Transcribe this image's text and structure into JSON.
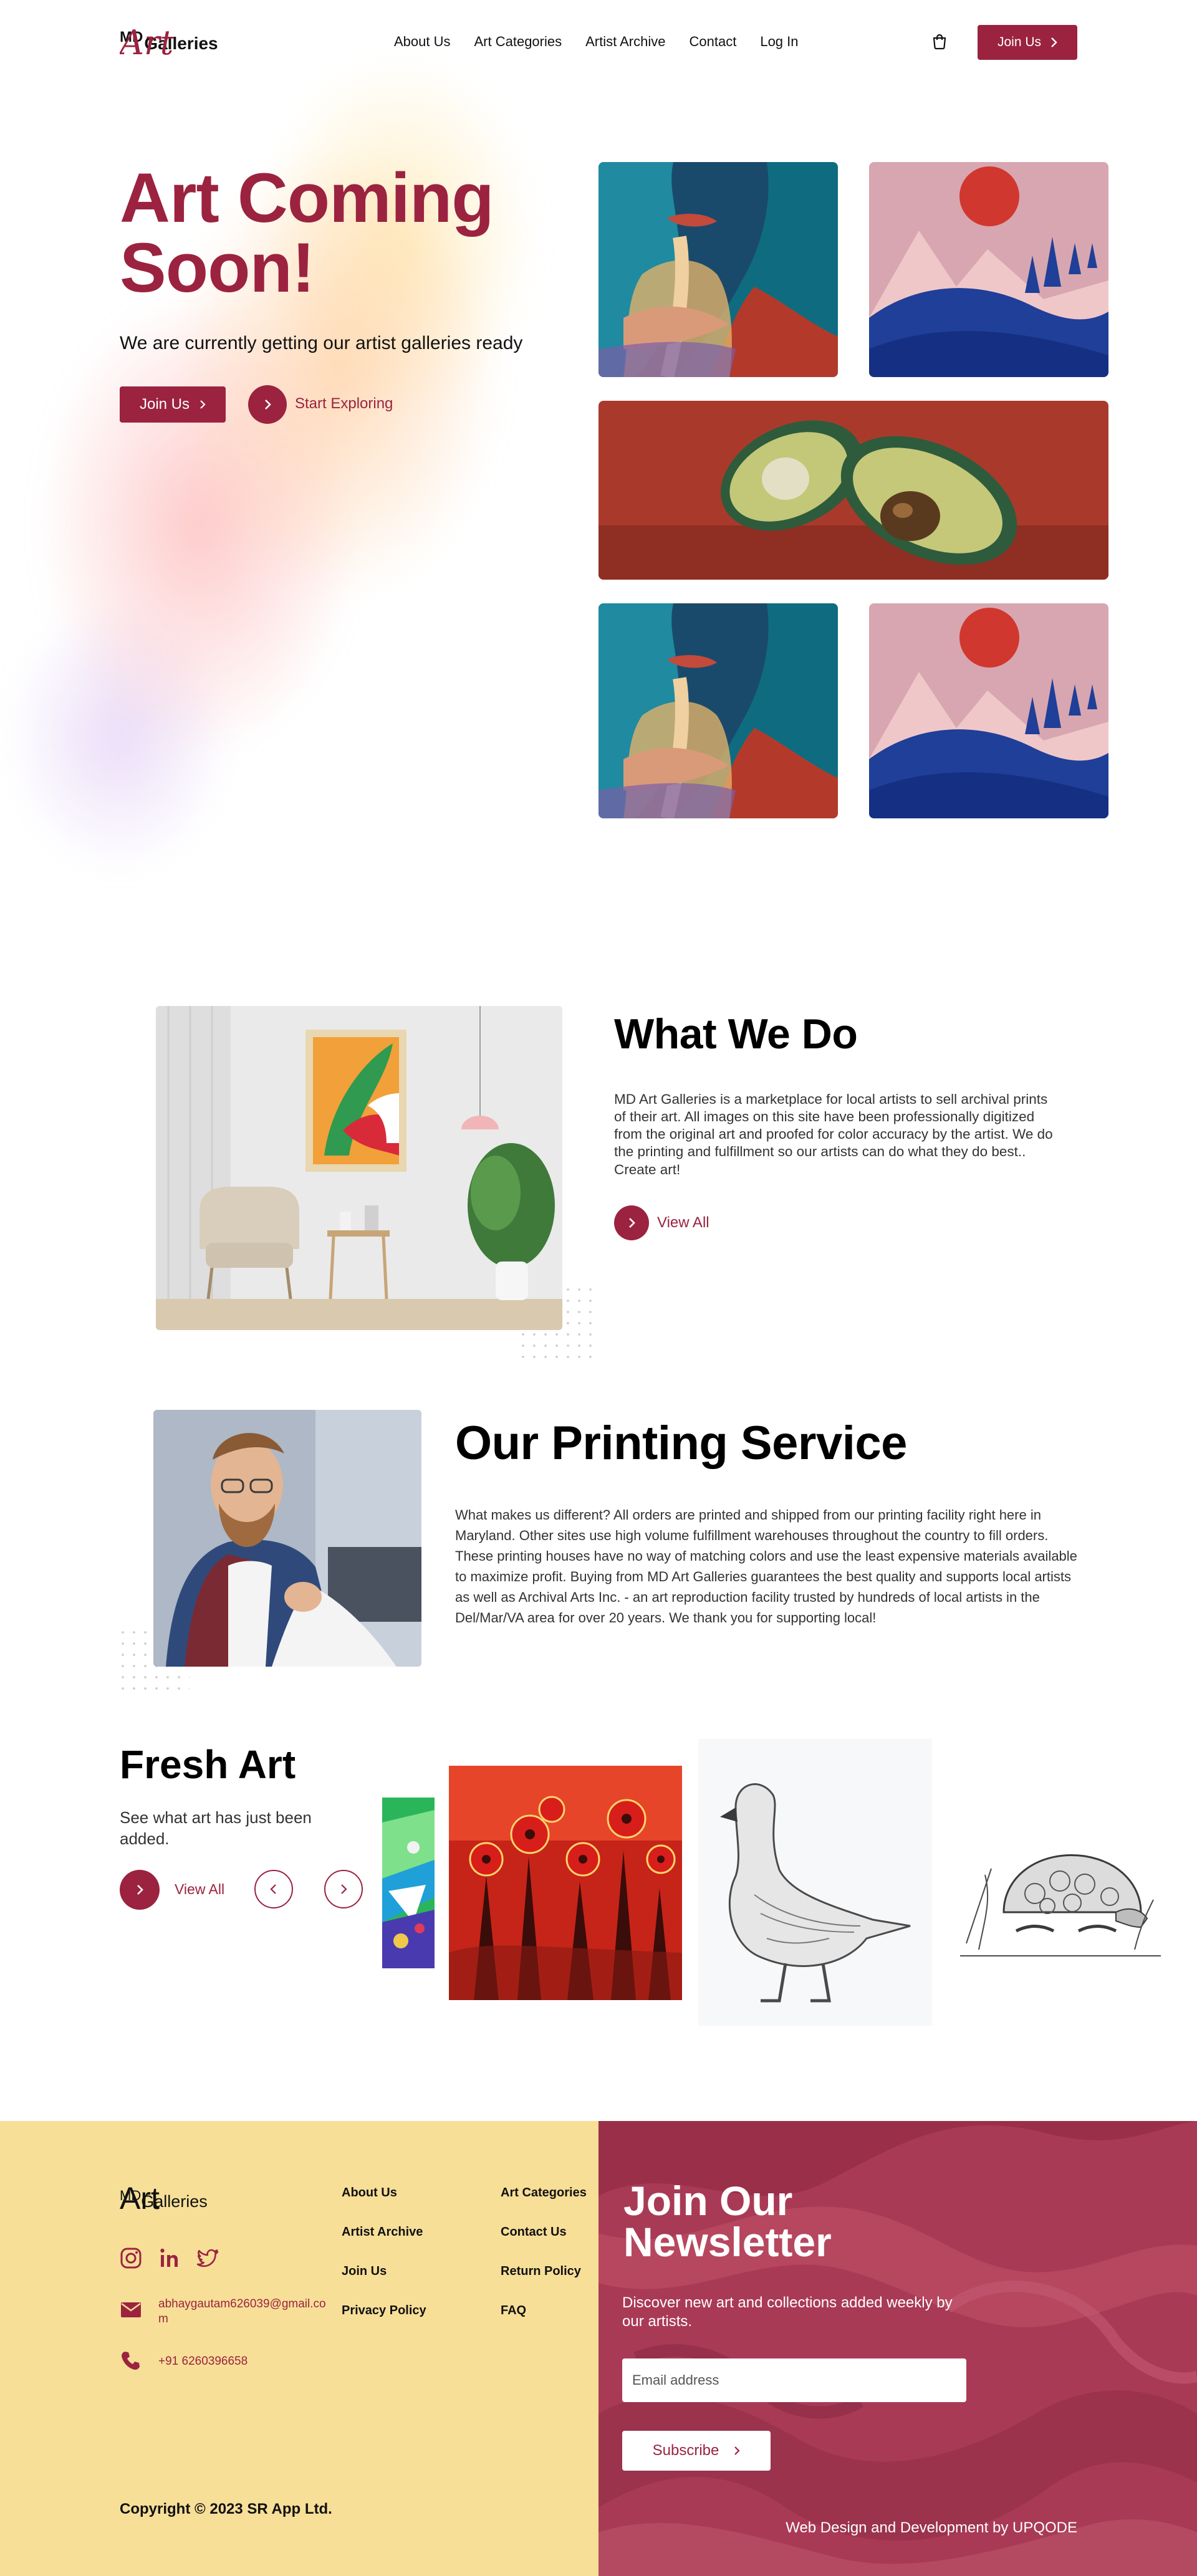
{
  "header": {
    "logo": {
      "md": "MD",
      "art": "Art",
      "galleries": "Galleries"
    },
    "nav": [
      "About Us",
      "Art Categories",
      "Artist Archive",
      "Contact",
      "Log In"
    ],
    "join_label": "Join Us"
  },
  "hero": {
    "title": "Art Coming Soon!",
    "subtitle": "We are currently getting our artist galleries ready",
    "join_label": "Join Us",
    "explore_label": "Start Exploring"
  },
  "what_we_do": {
    "title": "What We Do",
    "text": "MD Art Galleries is a marketplace for local artists to sell archival prints of their art. All images on this site have been professionally digitized from the original art and proofed for color accuracy by the artist. We do the printing and fulfillment so our artists can do what they do best.. Create art!",
    "view_label": "View All"
  },
  "printing": {
    "title": "Our Printing Service",
    "text": "What makes us different? All orders are printed and shipped from our printing facility right here in Maryland. Other sites use high volume fulfillment warehouses throughout the country to fill orders. These printing houses have no way of matching colors and use the least expensive materials available to maximize profit. Buying from MD Art Galleries guarantees the best quality and supports local artists as well as Archival Arts Inc. - an art reproduction facility trusted by hundreds of local artists in the Del/Mar/VA area for over 20 years. We thank you for supporting local!"
  },
  "fresh_art": {
    "title": "Fresh Art",
    "subtitle": "See what art has just been added.",
    "view_label": "View All"
  },
  "footer": {
    "logo": {
      "md": "MD",
      "art": "Art",
      "galleries": "Galleries"
    },
    "social": [
      "instagram-icon",
      "linkedin-icon",
      "twitter-icon"
    ],
    "email": "abhaygautam626039@gmail.com",
    "phone": "+91 6260396658",
    "links_col1": [
      "About Us",
      "Artist Archive",
      "Join Us",
      "Privacy Policy"
    ],
    "links_col2": [
      "Art Categories",
      "Contact Us",
      "Return Policy",
      "FAQ"
    ],
    "copyright": "Copyright © 2023 SR App Ltd.",
    "newsletter": {
      "title": "Join Our Newsletter",
      "subtitle": "Discover new art and collections added weekly by our artists.",
      "placeholder": "Email address",
      "subscribe_label": "Subscribe"
    },
    "credit": "Web Design and Development by UPQODE"
  },
  "colors": {
    "brand": "#9b2340",
    "footer_left": "#f7df98",
    "footer_right": "#a93a55"
  }
}
